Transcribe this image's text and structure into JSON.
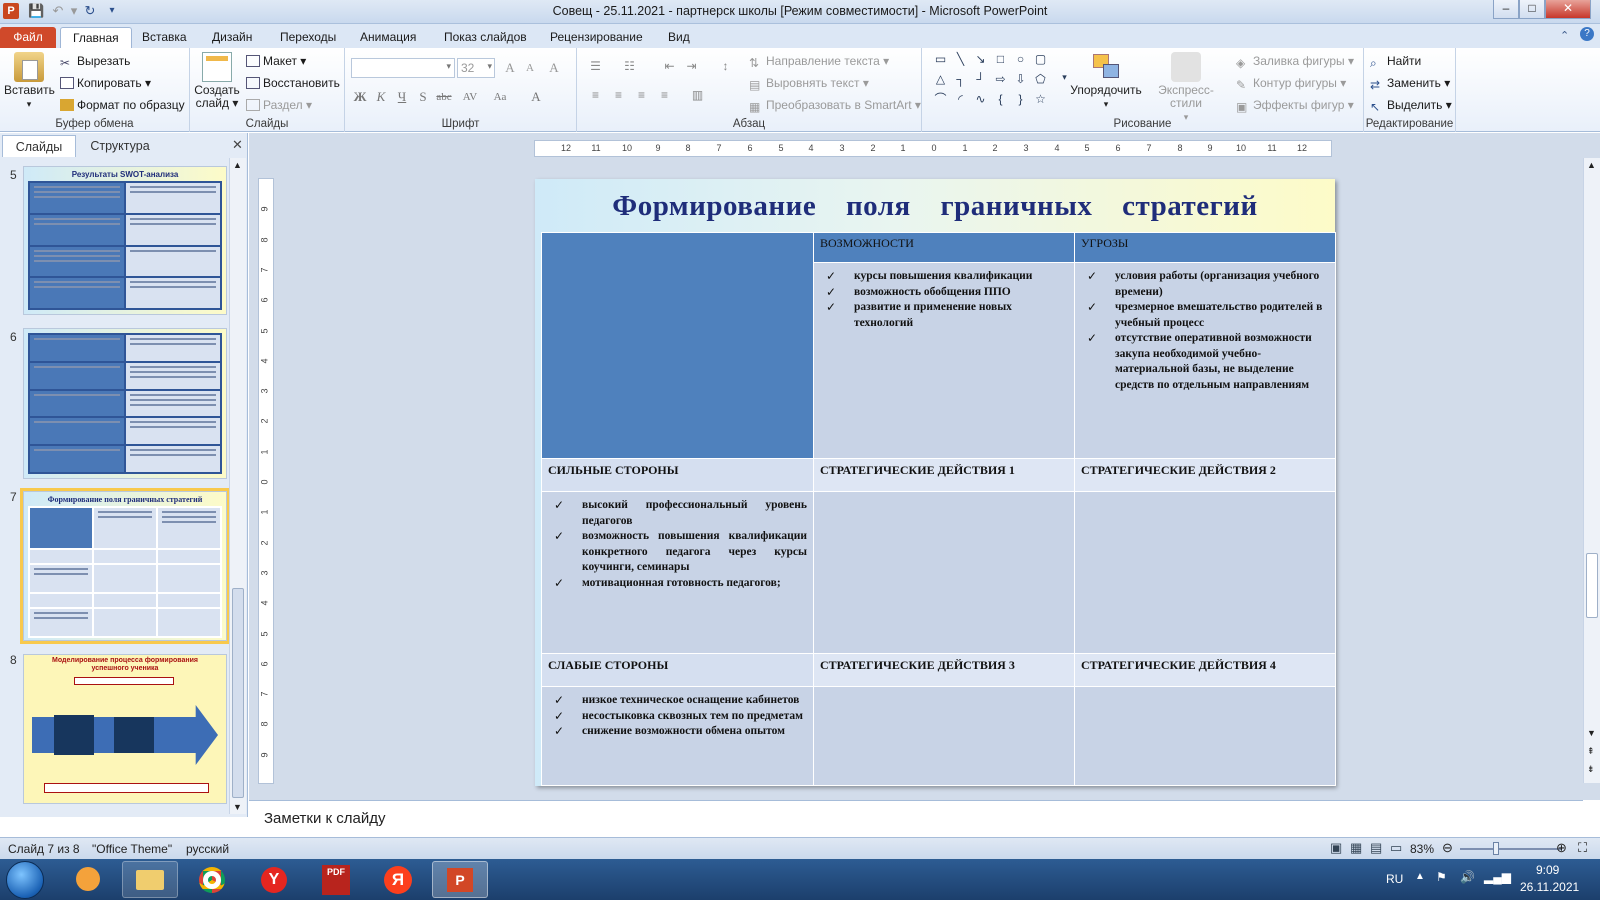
{
  "window": {
    "title": "Совещ - 25.11.2021 - партнерск школы [Режим совместимости] - Microsoft PowerPoint",
    "app_letter": "P",
    "minimize": "–",
    "maximize": "□",
    "close": "✕"
  },
  "tabs": [
    "Файл",
    "Главная",
    "Вставка",
    "Дизайн",
    "Переходы",
    "Анимация",
    "Показ слайдов",
    "Рецензирование",
    "Вид"
  ],
  "ribbon": {
    "clipboard": {
      "paste": "Вставить",
      "cut": "Вырезать",
      "copy": "Копировать",
      "format": "Формат по образцу",
      "label": "Буфер обмена"
    },
    "slides": {
      "create": "Создать",
      "create2": "слайд",
      "layout": "Макет",
      "reset": "Восстановить",
      "section": "Раздел",
      "label": "Слайды"
    },
    "font": {
      "name": "",
      "size": "32",
      "label": "Шрифт",
      "bold": "Ж",
      "italic": "К",
      "underline": "Ч",
      "shadow": "S",
      "strike": "abc",
      "spacing": "AV",
      "case": "Aa",
      "color": "A",
      "grow": "A",
      "shrink": "A",
      "clear": "A"
    },
    "paragraph": {
      "text_dir": "Направление текста",
      "align_text": "Выровнять текст",
      "smartart": "Преобразовать в SmartArt",
      "label": "Абзац"
    },
    "drawing": {
      "arrange": "Упорядочить",
      "quick_styles": "Экспресс-стили",
      "fill": "Заливка фигуры",
      "outline": "Контур фигуры",
      "effects": "Эффекты фигур",
      "label": "Рисование"
    },
    "editing": {
      "find": "Найти",
      "replace": "Заменить",
      "select": "Выделить",
      "label": "Редактирование"
    }
  },
  "left_pane": {
    "tab_slides": "Слайды",
    "tab_outline": "Структура",
    "thumbs": [
      {
        "num": "5",
        "title": "Результаты SWOT-анализа"
      },
      {
        "num": "6",
        "title": ""
      },
      {
        "num": "7",
        "title": "Формирование поля граничных стратегий"
      },
      {
        "num": "8",
        "title": "Моделирование процесса формирования успешного ученика"
      }
    ]
  },
  "ruler": {
    "ticks": [
      "12",
      "11",
      "10",
      "9",
      "8",
      "7",
      "6",
      "5",
      "4",
      "3",
      "2",
      "1",
      "0",
      "1",
      "2",
      "3",
      "4",
      "5",
      "6",
      "7",
      "8",
      "9",
      "10",
      "11",
      "12"
    ]
  },
  "slide": {
    "title": "Формирование поля граничных стратегий",
    "col_opportunities": "ВОЗМОЖНОСТИ",
    "col_threats": "УГРОЗЫ",
    "opportunities": [
      "курсы повышения квалификации",
      "возможность обобщения ППО",
      "развитие и применение новых технологий"
    ],
    "threats": [
      "условия работы (организация учебного времени)",
      "чрезмерное вмешательство родителей в учебный процесс",
      "отсутствие оперативной возможности закупа необходимой учебно-материальной базы, не выделение средств по отдельным направлениям"
    ],
    "row_strengths": "СИЛЬНЫЕ СТОРОНЫ",
    "strengths": [
      "высокий профессиональный уровень педагогов",
      "возможность повышения квалификации конкретного педагога через курсы коучинги, семинары",
      "мотивационная готовность педагогов;"
    ],
    "row_weaknesses": "СЛАБЫЕ СТОРОНЫ",
    "weaknesses": [
      "низкое техническое оснащение кабинетов",
      "несостыковка сквозных тем по предметам",
      "снижение возможности обмена опытом"
    ],
    "sa1": "СТРАТЕГИЧЕСКИЕ ДЕЙСТВИЯ 1",
    "sa2": "СТРАТЕГИЧЕСКИЕ ДЕЙСТВИЯ 2",
    "sa3": "СТРАТЕГИЧЕСКИЕ ДЕЙСТВИЯ 3",
    "sa4": "СТРАТЕГИЧЕСКИЕ ДЕЙСТВИЯ 4"
  },
  "notes": {
    "placeholder": "Заметки к слайду"
  },
  "status": {
    "slide": "Слайд 7 из 8",
    "theme": "\"Office Theme\"",
    "lang": "русский",
    "zoom": "83%"
  },
  "taskbar": {
    "lang": "RU",
    "time": "9:09",
    "date": "26.11.2021",
    "pdf": "PDF"
  }
}
